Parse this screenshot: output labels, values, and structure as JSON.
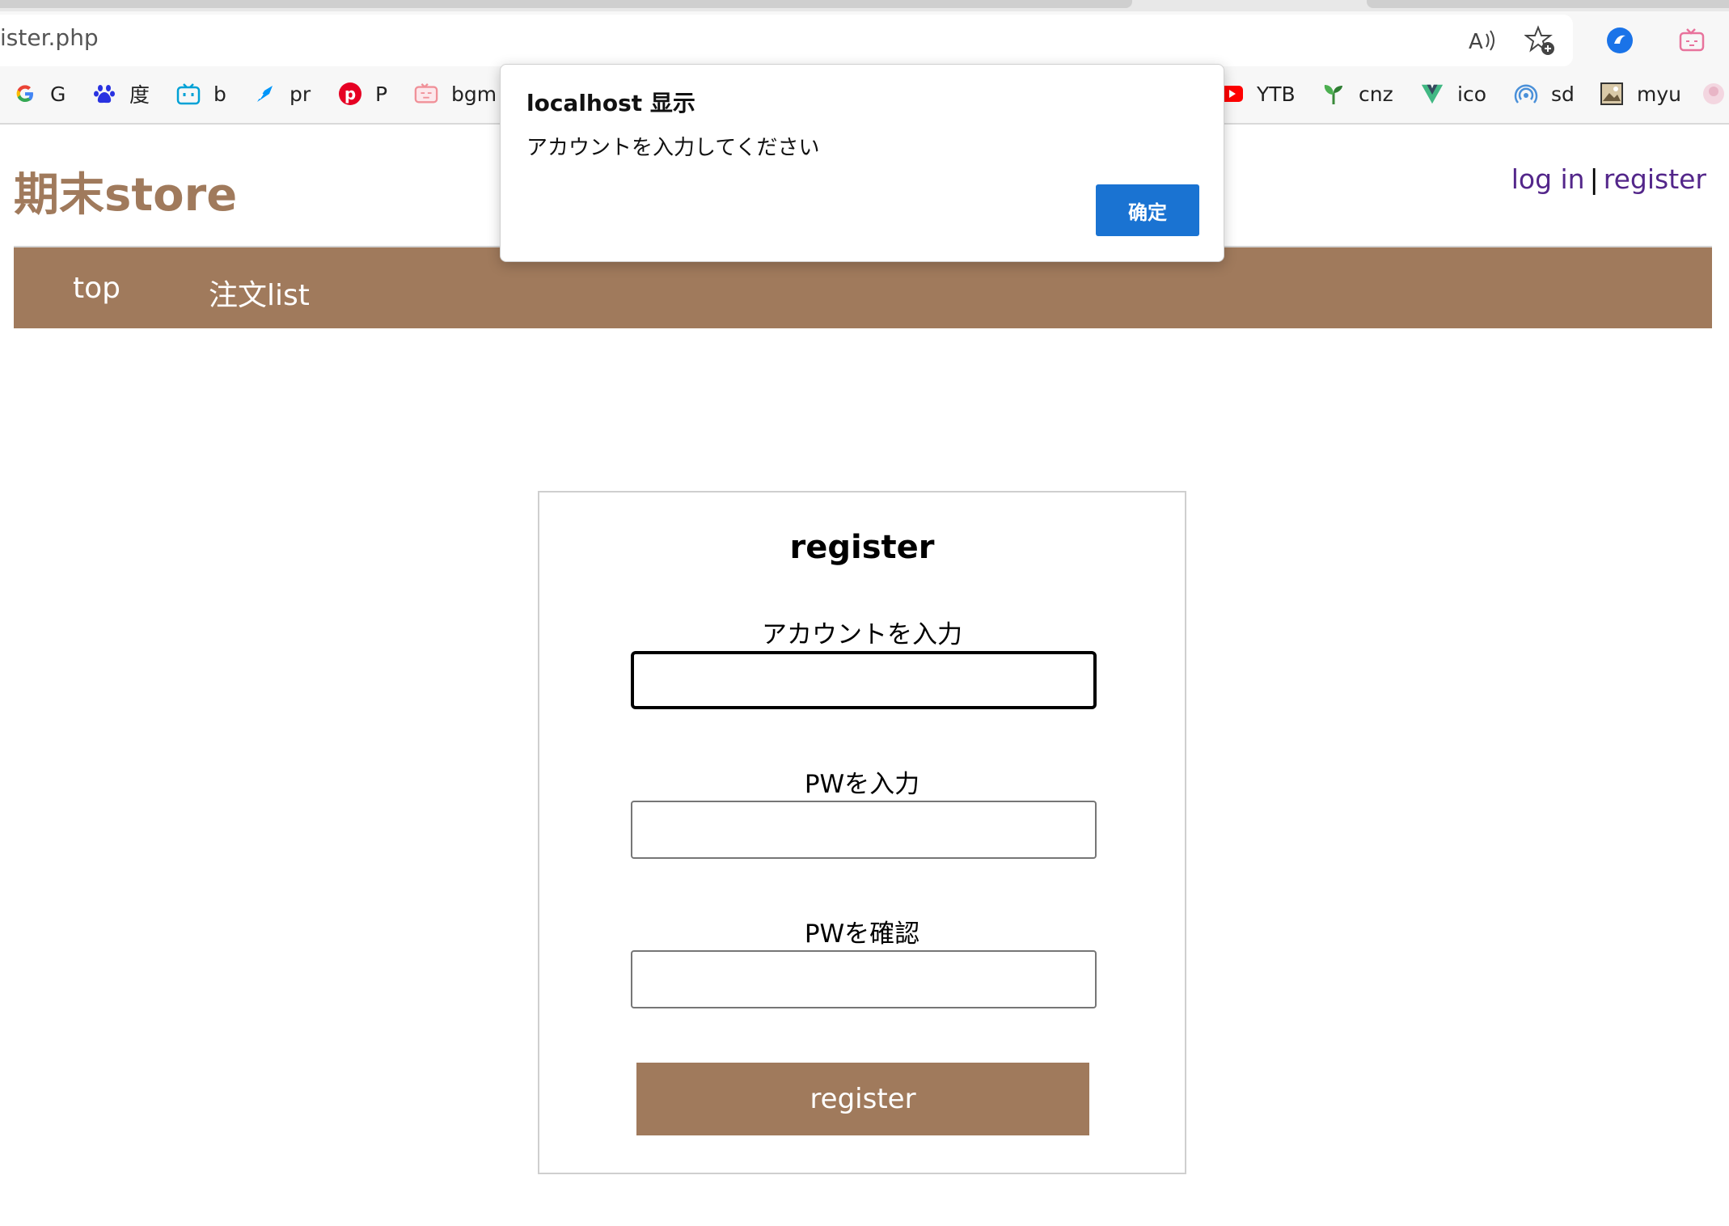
{
  "browser": {
    "address": "ister.php",
    "bookmarks": [
      {
        "label": "G",
        "icon": "google-icon"
      },
      {
        "label": "度",
        "icon": "baidu-paw-icon"
      },
      {
        "label": "b",
        "icon": "bilibili-tv-icon"
      },
      {
        "label": "pr",
        "icon": "pixiv-icon"
      },
      {
        "label": "P",
        "icon": "pinterest-icon"
      },
      {
        "label": "bgm",
        "icon": "bangumi-tv-icon"
      },
      {
        "label": "YTB",
        "icon": "youtube-icon"
      },
      {
        "label": "cnz",
        "icon": "sprout-icon"
      },
      {
        "label": "ico",
        "icon": "vuetify-v-icon"
      },
      {
        "label": "sd",
        "icon": "signal-icon"
      },
      {
        "label": "myu",
        "icon": "image-thumb-icon"
      }
    ]
  },
  "site": {
    "title": "期末store",
    "login": "log in",
    "separator": "|",
    "register": "register"
  },
  "nav": {
    "top": "top",
    "orders": "注文list"
  },
  "form": {
    "title": "register",
    "account_label": "アカウントを入力",
    "password_label": "PWを入力",
    "confirm_label": "PWを確認",
    "submit": "register"
  },
  "alert": {
    "title": "localhost 显示",
    "message": "アカウントを入力してください",
    "ok": "确定"
  },
  "colors": {
    "brand": "#a07a5c",
    "link": "#53268a",
    "dialog_button": "#1a73d2"
  }
}
